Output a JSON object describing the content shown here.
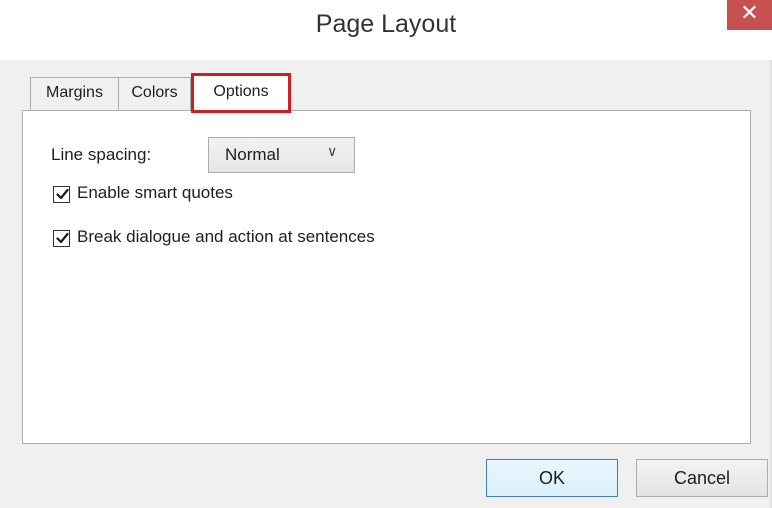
{
  "dialog": {
    "title": "Page Layout",
    "close_glyph": "✕"
  },
  "tabs": [
    {
      "label": "Margins",
      "selected": false
    },
    {
      "label": "Colors",
      "selected": false
    },
    {
      "label": "Options",
      "selected": true
    }
  ],
  "options": {
    "line_spacing_label": "Line spacing:",
    "line_spacing_value": "Normal",
    "smart_quotes_label": "Enable smart quotes",
    "smart_quotes_checked": true,
    "break_dialogue_label": "Break dialogue and action at sentences",
    "break_dialogue_checked": true
  },
  "buttons": {
    "ok_label": "OK",
    "cancel_label": "Cancel"
  },
  "colors": {
    "close_button": "#c75050",
    "highlight_border": "#cc1f1f",
    "default_button_border": "#3c7fb1"
  },
  "icons": {
    "close": "close-icon",
    "dropdown": "chevron-down-icon",
    "check": "checkmark-icon"
  }
}
